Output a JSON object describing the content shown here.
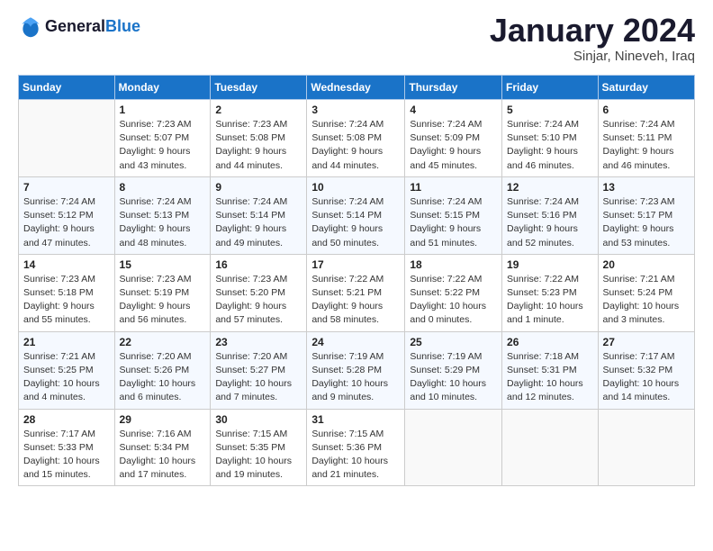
{
  "logo": {
    "line1": "General",
    "line2": "Blue"
  },
  "title": "January 2024",
  "subtitle": "Sinjar, Nineveh, Iraq",
  "days_header": [
    "Sunday",
    "Monday",
    "Tuesday",
    "Wednesday",
    "Thursday",
    "Friday",
    "Saturday"
  ],
  "weeks": [
    [
      {
        "day": "",
        "info": ""
      },
      {
        "day": "1",
        "info": "Sunrise: 7:23 AM\nSunset: 5:07 PM\nDaylight: 9 hours\nand 43 minutes."
      },
      {
        "day": "2",
        "info": "Sunrise: 7:23 AM\nSunset: 5:08 PM\nDaylight: 9 hours\nand 44 minutes."
      },
      {
        "day": "3",
        "info": "Sunrise: 7:24 AM\nSunset: 5:08 PM\nDaylight: 9 hours\nand 44 minutes."
      },
      {
        "day": "4",
        "info": "Sunrise: 7:24 AM\nSunset: 5:09 PM\nDaylight: 9 hours\nand 45 minutes."
      },
      {
        "day": "5",
        "info": "Sunrise: 7:24 AM\nSunset: 5:10 PM\nDaylight: 9 hours\nand 46 minutes."
      },
      {
        "day": "6",
        "info": "Sunrise: 7:24 AM\nSunset: 5:11 PM\nDaylight: 9 hours\nand 46 minutes."
      }
    ],
    [
      {
        "day": "7",
        "info": "Sunrise: 7:24 AM\nSunset: 5:12 PM\nDaylight: 9 hours\nand 47 minutes."
      },
      {
        "day": "8",
        "info": "Sunrise: 7:24 AM\nSunset: 5:13 PM\nDaylight: 9 hours\nand 48 minutes."
      },
      {
        "day": "9",
        "info": "Sunrise: 7:24 AM\nSunset: 5:14 PM\nDaylight: 9 hours\nand 49 minutes."
      },
      {
        "day": "10",
        "info": "Sunrise: 7:24 AM\nSunset: 5:14 PM\nDaylight: 9 hours\nand 50 minutes."
      },
      {
        "day": "11",
        "info": "Sunrise: 7:24 AM\nSunset: 5:15 PM\nDaylight: 9 hours\nand 51 minutes."
      },
      {
        "day": "12",
        "info": "Sunrise: 7:24 AM\nSunset: 5:16 PM\nDaylight: 9 hours\nand 52 minutes."
      },
      {
        "day": "13",
        "info": "Sunrise: 7:23 AM\nSunset: 5:17 PM\nDaylight: 9 hours\nand 53 minutes."
      }
    ],
    [
      {
        "day": "14",
        "info": "Sunrise: 7:23 AM\nSunset: 5:18 PM\nDaylight: 9 hours\nand 55 minutes."
      },
      {
        "day": "15",
        "info": "Sunrise: 7:23 AM\nSunset: 5:19 PM\nDaylight: 9 hours\nand 56 minutes."
      },
      {
        "day": "16",
        "info": "Sunrise: 7:23 AM\nSunset: 5:20 PM\nDaylight: 9 hours\nand 57 minutes."
      },
      {
        "day": "17",
        "info": "Sunrise: 7:22 AM\nSunset: 5:21 PM\nDaylight: 9 hours\nand 58 minutes."
      },
      {
        "day": "18",
        "info": "Sunrise: 7:22 AM\nSunset: 5:22 PM\nDaylight: 10 hours\nand 0 minutes."
      },
      {
        "day": "19",
        "info": "Sunrise: 7:22 AM\nSunset: 5:23 PM\nDaylight: 10 hours\nand 1 minute."
      },
      {
        "day": "20",
        "info": "Sunrise: 7:21 AM\nSunset: 5:24 PM\nDaylight: 10 hours\nand 3 minutes."
      }
    ],
    [
      {
        "day": "21",
        "info": "Sunrise: 7:21 AM\nSunset: 5:25 PM\nDaylight: 10 hours\nand 4 minutes."
      },
      {
        "day": "22",
        "info": "Sunrise: 7:20 AM\nSunset: 5:26 PM\nDaylight: 10 hours\nand 6 minutes."
      },
      {
        "day": "23",
        "info": "Sunrise: 7:20 AM\nSunset: 5:27 PM\nDaylight: 10 hours\nand 7 minutes."
      },
      {
        "day": "24",
        "info": "Sunrise: 7:19 AM\nSunset: 5:28 PM\nDaylight: 10 hours\nand 9 minutes."
      },
      {
        "day": "25",
        "info": "Sunrise: 7:19 AM\nSunset: 5:29 PM\nDaylight: 10 hours\nand 10 minutes."
      },
      {
        "day": "26",
        "info": "Sunrise: 7:18 AM\nSunset: 5:31 PM\nDaylight: 10 hours\nand 12 minutes."
      },
      {
        "day": "27",
        "info": "Sunrise: 7:17 AM\nSunset: 5:32 PM\nDaylight: 10 hours\nand 14 minutes."
      }
    ],
    [
      {
        "day": "28",
        "info": "Sunrise: 7:17 AM\nSunset: 5:33 PM\nDaylight: 10 hours\nand 15 minutes."
      },
      {
        "day": "29",
        "info": "Sunrise: 7:16 AM\nSunset: 5:34 PM\nDaylight: 10 hours\nand 17 minutes."
      },
      {
        "day": "30",
        "info": "Sunrise: 7:15 AM\nSunset: 5:35 PM\nDaylight: 10 hours\nand 19 minutes."
      },
      {
        "day": "31",
        "info": "Sunrise: 7:15 AM\nSunset: 5:36 PM\nDaylight: 10 hours\nand 21 minutes."
      },
      {
        "day": "",
        "info": ""
      },
      {
        "day": "",
        "info": ""
      },
      {
        "day": "",
        "info": ""
      }
    ]
  ]
}
